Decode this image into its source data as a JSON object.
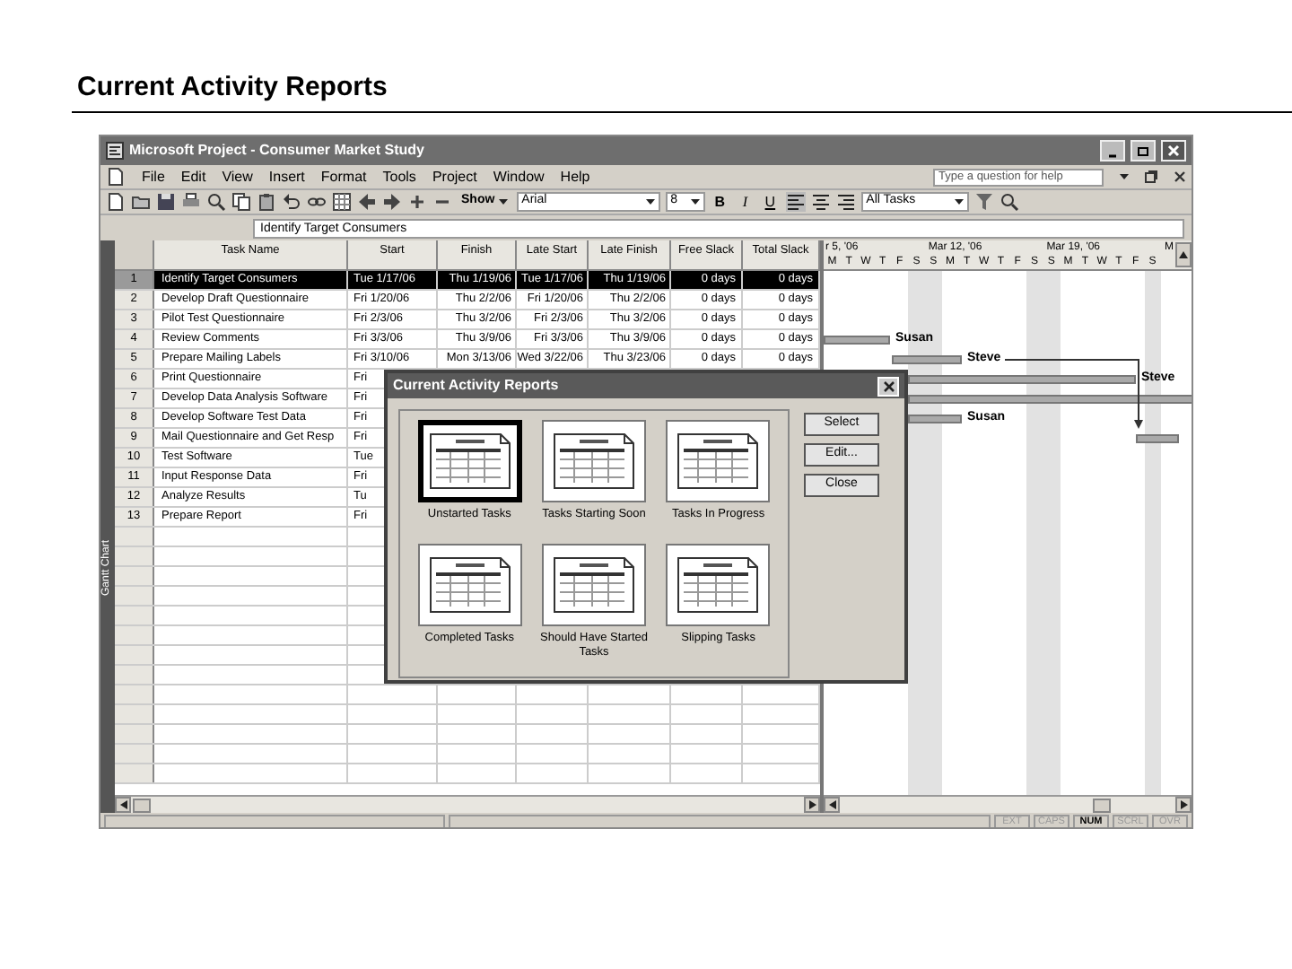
{
  "slide": {
    "title": "Current Activity Reports"
  },
  "window": {
    "title": "Microsoft Project - Consumer Market Study"
  },
  "menu": [
    "File",
    "Edit",
    "View",
    "Insert",
    "Format",
    "Tools",
    "Project",
    "Window",
    "Help"
  ],
  "help_box": {
    "placeholder": "Type a question for help"
  },
  "toolbar": {
    "show": "Show",
    "font": "Arial",
    "size": "8",
    "bold": "B",
    "italic": "I",
    "underline": "U",
    "filter": "All Tasks"
  },
  "entry_bar": {
    "value": "Identify Target Consumers"
  },
  "view_bar": {
    "label": "Gantt Chart"
  },
  "table": {
    "columns": [
      "Task Name",
      "Start",
      "Finish",
      "Late Start",
      "Late Finish",
      "Free Slack",
      "Total Slack"
    ],
    "rows": [
      {
        "id": "1",
        "name": "Identify Target Consumers",
        "start": "Tue 1/17/06",
        "finish": "Thu 1/19/06",
        "late_start": "Tue 1/17/06",
        "late_finish": "Thu 1/19/06",
        "free_slack": "0 days",
        "total_slack": "0 days",
        "selected": true
      },
      {
        "id": "2",
        "name": "Develop Draft Questionnaire",
        "start": "Fri 1/20/06",
        "finish": "Thu 2/2/06",
        "late_start": "Fri 1/20/06",
        "late_finish": "Thu 2/2/06",
        "free_slack": "0 days",
        "total_slack": "0 days",
        "selected": false
      },
      {
        "id": "3",
        "name": "Pilot Test Questionnaire",
        "start": "Fri 2/3/06",
        "finish": "Thu 3/2/06",
        "late_start": "Fri 2/3/06",
        "late_finish": "Thu 3/2/06",
        "free_slack": "0 days",
        "total_slack": "0 days",
        "selected": false
      },
      {
        "id": "4",
        "name": "Review Comments",
        "start": "Fri 3/3/06",
        "finish": "Thu 3/9/06",
        "late_start": "Fri 3/3/06",
        "late_finish": "Thu 3/9/06",
        "free_slack": "0 days",
        "total_slack": "0 days",
        "resource": "Susan",
        "selected": false
      },
      {
        "id": "5",
        "name": "Prepare Mailing Labels",
        "start": "Fri 3/10/06",
        "finish": "Mon 3/13/06",
        "late_start": "Wed 3/22/06",
        "late_finish": "Thu 3/23/06",
        "free_slack": "0 days",
        "total_slack": "0 days",
        "resource": "Steve",
        "selected": false
      },
      {
        "id": "6",
        "name": "Print Questionnaire",
        "start": "Fri",
        "resource": "Steve",
        "selected": false
      },
      {
        "id": "7",
        "name": "Develop Data Analysis Software",
        "start": "Fri",
        "selected": false
      },
      {
        "id": "8",
        "name": "Develop Software Test Data",
        "start": "Fri",
        "resource": "Susan",
        "selected": false
      },
      {
        "id": "9",
        "name": "Mail Questionnaire and Get Resp",
        "start": "Fri",
        "selected": false
      },
      {
        "id": "10",
        "name": "Test Software",
        "start": "Tue",
        "selected": false
      },
      {
        "id": "11",
        "name": "Input Response Data",
        "start": "Fri",
        "selected": false
      },
      {
        "id": "12",
        "name": "Analyze Results",
        "start": "Tu",
        "selected": false
      },
      {
        "id": "13",
        "name": "Prepare Report",
        "start": "Fri",
        "selected": false
      }
    ]
  },
  "timescale": {
    "weeks": [
      "r 5, '06",
      "Mar 12, '06",
      "Mar 19, '06",
      "M"
    ],
    "days": [
      "M",
      "T",
      "W",
      "T",
      "F",
      "S",
      "S",
      "M",
      "T",
      "W",
      "T",
      "F",
      "S",
      "S",
      "M",
      "T",
      "W",
      "T",
      "F",
      "S"
    ]
  },
  "dialog": {
    "title": "Current Activity Reports",
    "reports": [
      {
        "label": "Unstarted Tasks",
        "selected": true
      },
      {
        "label": "Tasks Starting Soon",
        "selected": false
      },
      {
        "label": "Tasks In Progress",
        "selected": false
      },
      {
        "label": "Completed Tasks",
        "selected": false
      },
      {
        "label": "Should Have Started Tasks",
        "selected": false
      },
      {
        "label": "Slipping Tasks",
        "selected": false
      }
    ],
    "buttons": [
      "Select",
      "Edit...",
      "Close"
    ]
  },
  "status_bar": {
    "indicators": [
      {
        "label": "EXT",
        "on": false
      },
      {
        "label": "CAPS",
        "on": false
      },
      {
        "label": "NUM",
        "on": true
      },
      {
        "label": "SCRL",
        "on": false
      },
      {
        "label": "OVR",
        "on": false
      }
    ]
  }
}
